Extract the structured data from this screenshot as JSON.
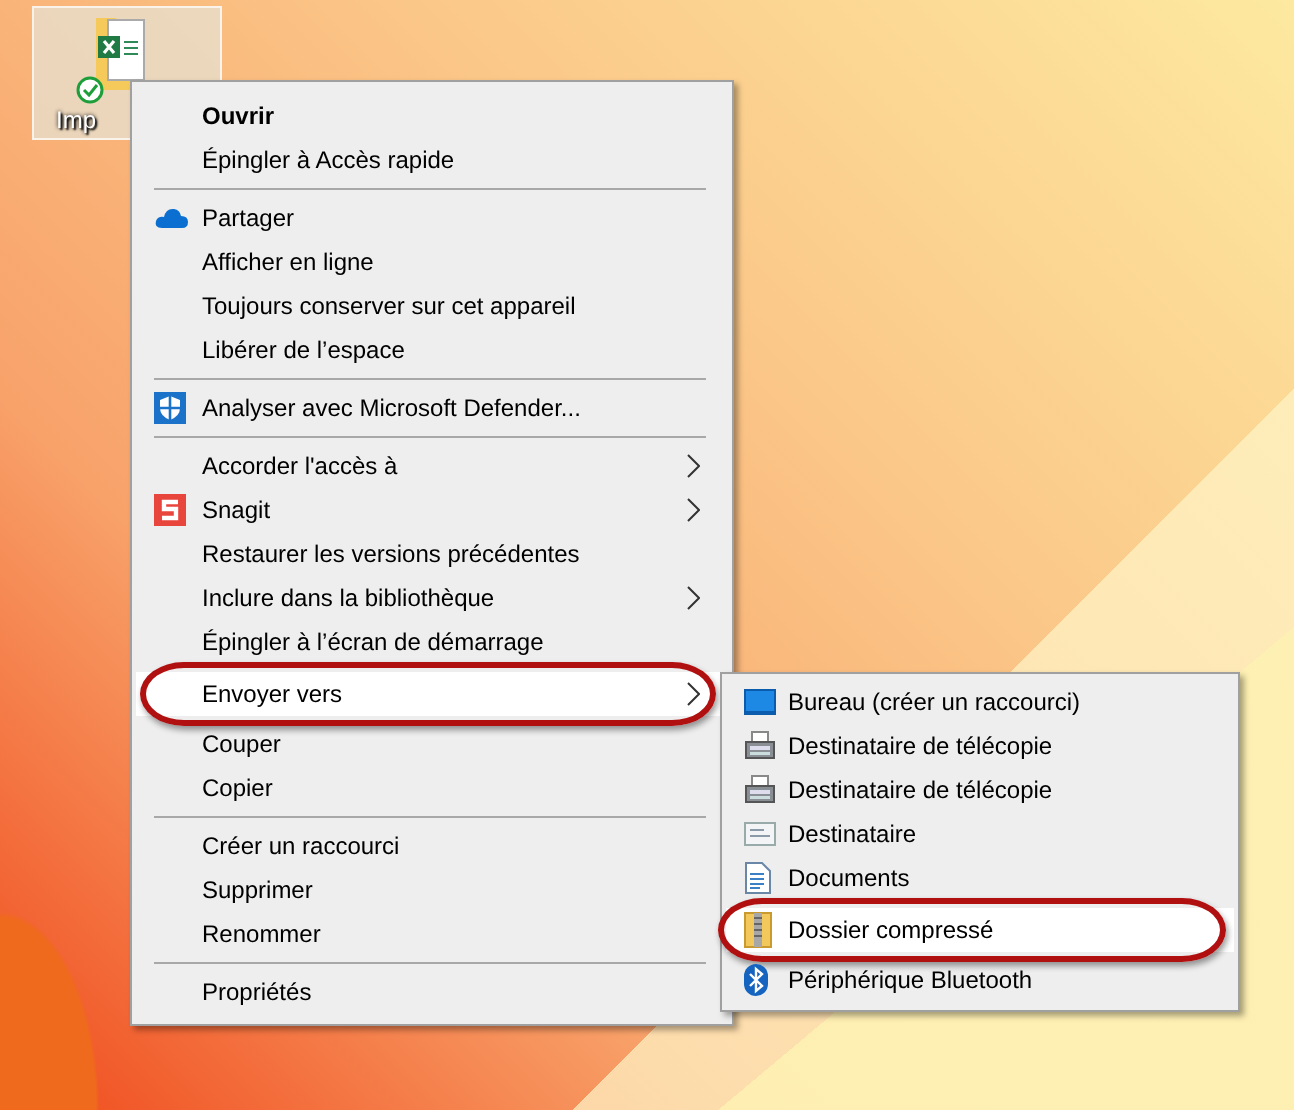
{
  "desktop_icon": {
    "label": "Imp",
    "synced": true
  },
  "context_menu": {
    "items": [
      {
        "kind": "plain",
        "label": "Ouvrir",
        "bold": true,
        "selected": false
      },
      {
        "kind": "plain",
        "label": "Épingler à Accès rapide",
        "selected": false
      },
      {
        "kind": "separator"
      },
      {
        "kind": "onedrive",
        "label": "Partager",
        "selected": false
      },
      {
        "kind": "plain",
        "label": "Afficher en ligne",
        "selected": false
      },
      {
        "kind": "plain",
        "label": "Toujours conserver sur cet appareil",
        "selected": false
      },
      {
        "kind": "plain",
        "label": "Libérer de l’espace",
        "selected": false
      },
      {
        "kind": "separator"
      },
      {
        "kind": "defender",
        "label": "Analyser avec Microsoft Defender...",
        "selected": false
      },
      {
        "kind": "separator"
      },
      {
        "kind": "plain",
        "label": "Accorder l'accès à",
        "submenu": true,
        "selected": false
      },
      {
        "kind": "snagit",
        "label": "Snagit",
        "submenu": true,
        "selected": false
      },
      {
        "kind": "plain",
        "label": "Restaurer les versions précédentes",
        "selected": false
      },
      {
        "kind": "plain",
        "label": "Inclure dans la bibliothèque",
        "submenu": true,
        "selected": false
      },
      {
        "kind": "plain",
        "label": "Épingler à l’écran de démarrage",
        "selected": false
      },
      {
        "kind": "plain",
        "label": "Envoyer vers",
        "submenu": true,
        "selected": true
      },
      {
        "kind": "plain",
        "label": "Couper",
        "selected": false
      },
      {
        "kind": "plain",
        "label": "Copier",
        "selected": false
      },
      {
        "kind": "separator"
      },
      {
        "kind": "plain",
        "label": "Créer un raccourci",
        "selected": false
      },
      {
        "kind": "plain",
        "label": "Supprimer",
        "selected": false
      },
      {
        "kind": "plain",
        "label": "Renommer",
        "selected": false
      },
      {
        "kind": "separator"
      },
      {
        "kind": "plain",
        "label": "Propriétés",
        "selected": false
      }
    ]
  },
  "send_to_menu": {
    "items": [
      {
        "kind": "desktop",
        "label": "Bureau (créer un raccourci)",
        "selected": false
      },
      {
        "kind": "fax",
        "label": "Destinataire de télécopie",
        "selected": false
      },
      {
        "kind": "fax",
        "label": "Destinataire de télécopie",
        "selected": false
      },
      {
        "kind": "mail",
        "label": "Destinataire",
        "selected": false
      },
      {
        "kind": "documents",
        "label": "Documents",
        "selected": false
      },
      {
        "kind": "zip",
        "label": "Dossier compressé",
        "selected": true
      },
      {
        "kind": "bluetooth",
        "label": "Périphérique Bluetooth",
        "selected": false
      }
    ]
  }
}
